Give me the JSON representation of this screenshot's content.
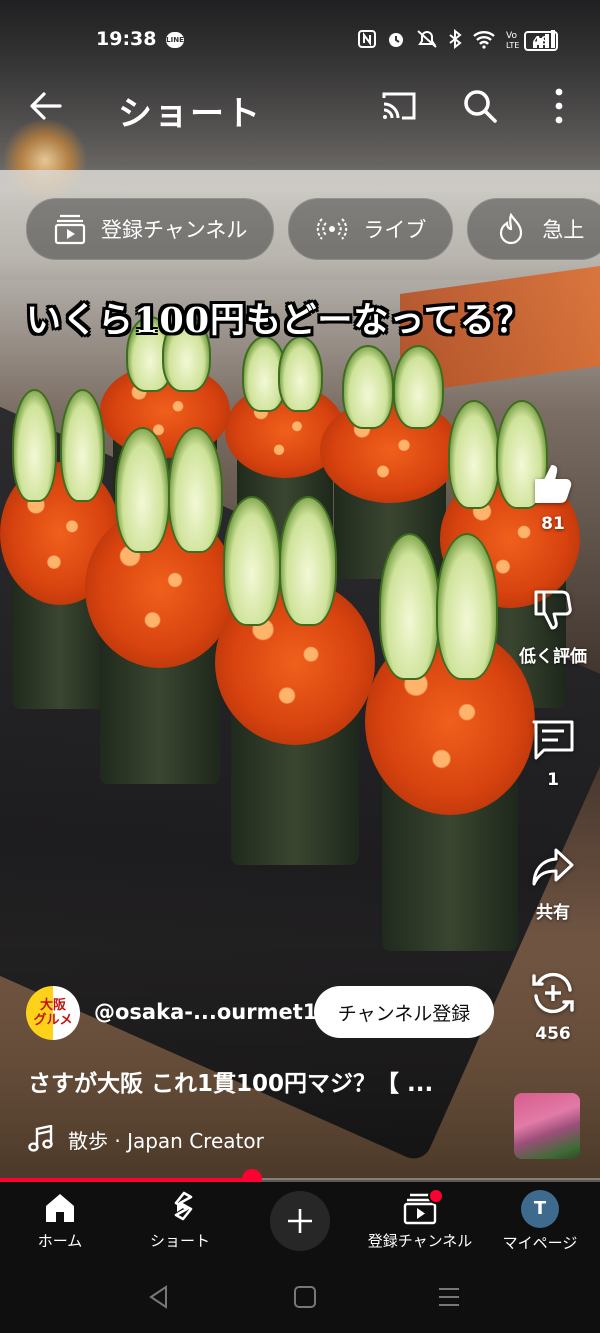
{
  "status_bar": {
    "time": "19:38",
    "battery": "49"
  },
  "app_bar": {
    "title": "ショート"
  },
  "chips": [
    {
      "label": "登録チャンネル",
      "icon": "subscriptions-icon"
    },
    {
      "label": "ライブ",
      "icon": "live-icon"
    },
    {
      "label": "急上",
      "icon": "trending-icon"
    }
  ],
  "video": {
    "caption": "いくら100円もどーなってる？",
    "channel_avatar_text_line1": "大阪",
    "channel_avatar_text_line2": "グルメ",
    "channel_handle": "@osaka-...ourmet1",
    "subscribe_label": "チャンネル登録",
    "title": "さすが大阪 これ1貫100円マジ？【 ...",
    "music": "散歩 · Japan Creator",
    "progress": 0.42
  },
  "actions": {
    "like_count": "81",
    "dislike_label": "低く評価",
    "comment_count": "1",
    "share_label": "共有",
    "remix_count": "456"
  },
  "bottom_nav": [
    {
      "label": "ホーム",
      "icon": "home-icon"
    },
    {
      "label": "ショート",
      "icon": "shorts-icon"
    },
    {
      "label": "",
      "icon": "create-icon"
    },
    {
      "label": "登録チャンネル",
      "icon": "subscriptions-icon"
    },
    {
      "label": "マイページ",
      "icon": "avatar-icon",
      "avatar_letter": "T"
    }
  ],
  "colors": {
    "accent": "#ff0033",
    "nav_bg": "#0f0f0f"
  }
}
